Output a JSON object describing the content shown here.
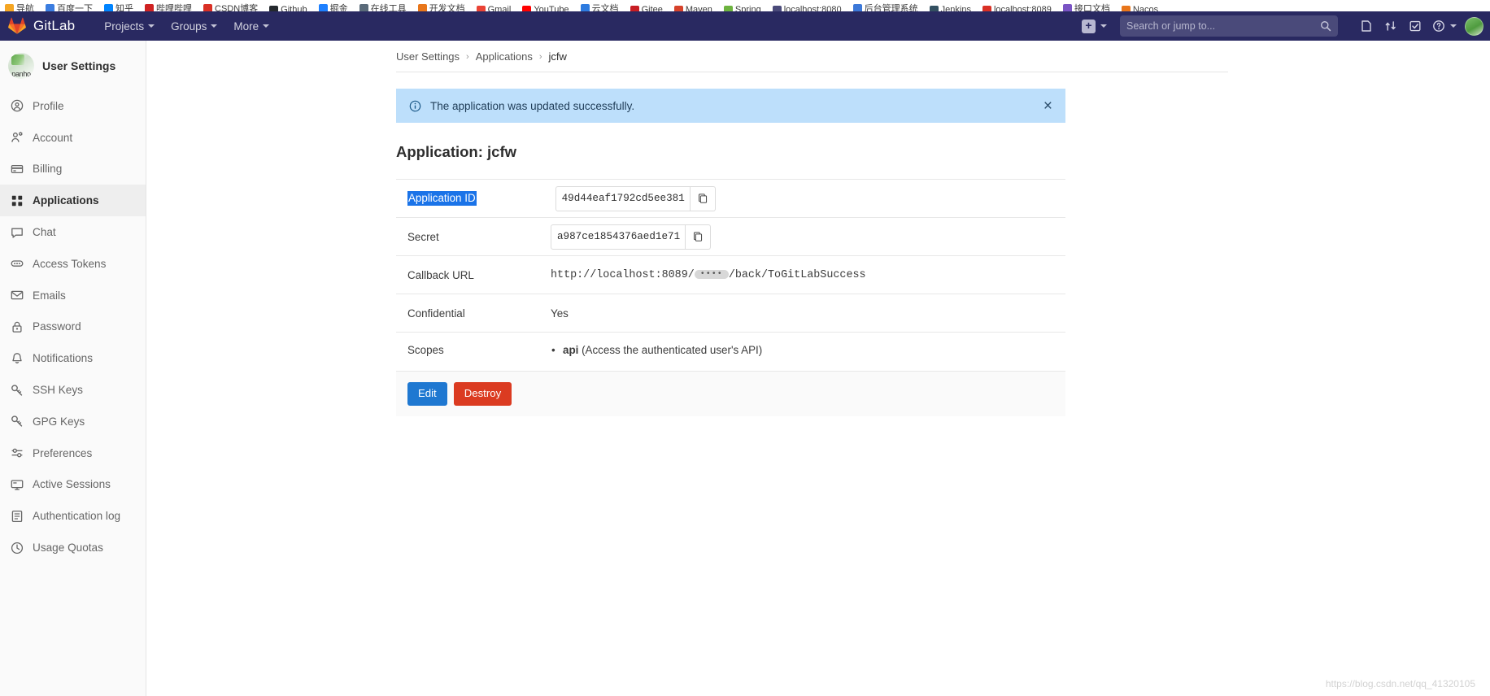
{
  "browser": {
    "bookmarks": [
      {
        "label": "导航",
        "color": "#f5a623"
      },
      {
        "label": "百度一下",
        "color": "#3b7de0"
      },
      {
        "label": "知乎",
        "color": "#0084ff"
      },
      {
        "label": "哔哩哔哩",
        "color": "#cf2222"
      },
      {
        "label": "CSDN博客",
        "color": "#d93025"
      },
      {
        "label": "Github",
        "color": "#24292e"
      },
      {
        "label": "掘金",
        "color": "#1e80ff"
      },
      {
        "label": "在线工具",
        "color": "#5a6b7a"
      },
      {
        "label": "开发文档",
        "color": "#e8761b"
      },
      {
        "label": "Gmail",
        "color": "#ea4335"
      },
      {
        "label": "YouTube",
        "color": "#ff0000"
      },
      {
        "label": "云文档",
        "color": "#2e7bdf"
      },
      {
        "label": "Gitee",
        "color": "#c71d23"
      },
      {
        "label": "Maven",
        "color": "#d6422b"
      },
      {
        "label": "Spring",
        "color": "#6db33f"
      },
      {
        "label": "localhost:8080",
        "color": "#4a4a7a"
      },
      {
        "label": "后台管理系统",
        "color": "#3c78d8"
      },
      {
        "label": "Jenkins",
        "color": "#335061"
      },
      {
        "label": "localhost:8089",
        "color": "#d93025"
      },
      {
        "label": "接口文档",
        "color": "#7a54c4"
      },
      {
        "label": "Nacos",
        "color": "#e8761b"
      }
    ]
  },
  "navbar": {
    "brand": "GitLab",
    "links": [
      {
        "label": "Projects",
        "name": "nav-projects"
      },
      {
        "label": "Groups",
        "name": "nav-groups"
      },
      {
        "label": "More",
        "name": "nav-more"
      }
    ],
    "search_placeholder": "Search or jump to...",
    "search_value": "",
    "icons": [
      {
        "name": "issues-icon",
        "title": "Issues"
      },
      {
        "name": "merge-requests-icon",
        "title": "Merge requests"
      },
      {
        "name": "todos-icon",
        "title": "To-Do List"
      },
      {
        "name": "help-icon",
        "title": "Help"
      }
    ]
  },
  "sidebar": {
    "title": "User Settings",
    "avatar_text": "panho",
    "items": [
      {
        "label": "Profile",
        "icon": "user-circle-icon",
        "active": false
      },
      {
        "label": "Account",
        "icon": "account-gear-icon",
        "active": false
      },
      {
        "label": "Billing",
        "icon": "credit-card-icon",
        "active": false
      },
      {
        "label": "Applications",
        "icon": "applications-grid-icon",
        "active": true
      },
      {
        "label": "Chat",
        "icon": "chat-bubble-icon",
        "active": false
      },
      {
        "label": "Access Tokens",
        "icon": "token-icon",
        "active": false
      },
      {
        "label": "Emails",
        "icon": "envelope-icon",
        "active": false
      },
      {
        "label": "Password",
        "icon": "lock-icon",
        "active": false
      },
      {
        "label": "Notifications",
        "icon": "bell-icon",
        "active": false
      },
      {
        "label": "SSH Keys",
        "icon": "key-icon",
        "active": false
      },
      {
        "label": "GPG Keys",
        "icon": "key-icon",
        "active": false
      },
      {
        "label": "Preferences",
        "icon": "sliders-icon",
        "active": false
      },
      {
        "label": "Active Sessions",
        "icon": "monitor-icon",
        "active": false
      },
      {
        "label": "Authentication log",
        "icon": "log-icon",
        "active": false
      },
      {
        "label": "Usage Quotas",
        "icon": "quota-clock-icon",
        "active": false
      }
    ]
  },
  "breadcrumb": {
    "item1": "User Settings",
    "item2": "Applications",
    "current": "jcfw",
    "sep": "›"
  },
  "alert": {
    "message": "The application was updated successfully.",
    "close_label": "×",
    "background": "#bddffb"
  },
  "page": {
    "title": "Application: jcfw"
  },
  "details": {
    "application_id": {
      "label": "Application ID",
      "value": "49d44eaf1792cd5ee381",
      "selected": true
    },
    "secret": {
      "label": "Secret",
      "value": "a987ce1854376aed1e71"
    },
    "callback_url": {
      "label": "Callback URL",
      "prefix": "http://localhost:8089/",
      "redacted": "••••",
      "suffix": "/back/ToGitLabSuccess"
    },
    "confidential": {
      "label": "Confidential",
      "value": "Yes"
    },
    "scopes": {
      "label": "Scopes",
      "items": [
        {
          "name": "api",
          "description": "(Access the authenticated user's API)"
        }
      ]
    }
  },
  "actions": {
    "edit_label": "Edit",
    "destroy_label": "Destroy",
    "edit_color": "#1f78d1",
    "destroy_color": "#db3b21"
  },
  "watermark": "https://blog.csdn.net/qq_41320105",
  "copy_tooltip": "Copy"
}
